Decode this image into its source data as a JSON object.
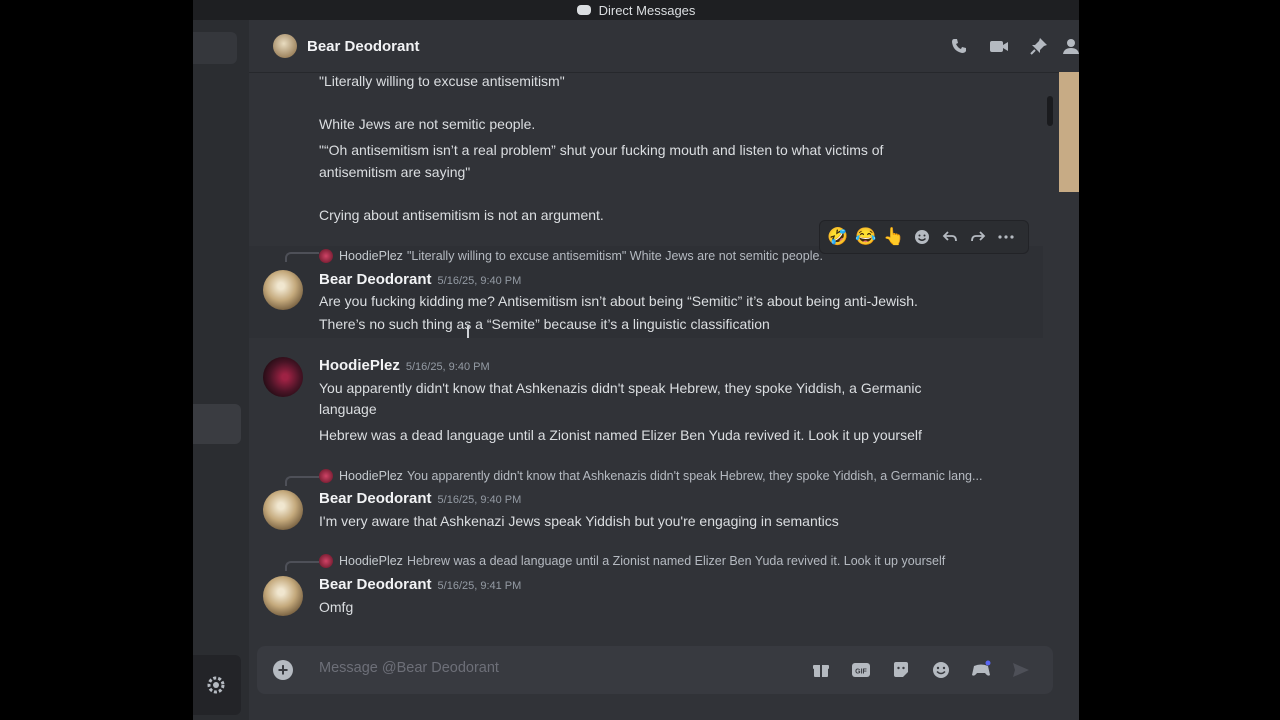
{
  "window": {
    "title": "Direct Messages"
  },
  "header": {
    "user_name": "Bear Deodorant"
  },
  "composer": {
    "placeholder": "Message @Bear Deodorant"
  },
  "messages": {
    "m1": "\"Literally willing to excuse antisemitism\"",
    "m2": "White Jews are not semitic people.",
    "m3a": "\"“Oh antisemitism isn’t a real problem” shut your fucking mouth and listen to what victims of",
    "m3b": "antisemitism are saying\"",
    "m4": "Crying about antisemitism is not an argument.",
    "r1_name": "HoodiePlez",
    "r1_text": "\"Literally willing to excuse antisemitism\"  White Jews are not semitic people.",
    "g1_name": "Bear Deodorant",
    "g1_time": "5/16/25, 9:40 PM",
    "g1_l1": "Are you fucking kidding me? Antisemitism isn’t about being “Semitic” it’s about being anti-Jewish.",
    "g1_l2": "There’s no such thing as a “Semite” because it’s a linguistic classification",
    "g2_name": "HoodiePlez",
    "g2_time": "5/16/25, 9:40 PM",
    "g2_l1": "You apparently didn't know that Ashkenazis didn't speak Hebrew, they spoke Yiddish, a Germanic",
    "g2_l2": "language",
    "g2_l3": "Hebrew was a dead language until a Zionist named Elizer Ben Yuda revived it. Look it up yourself",
    "r2_name": "HoodiePlez",
    "r2_text": "You apparently didn't know that Ashkenazis didn't speak Hebrew, they spoke Yiddish, a Germanic lang...",
    "g3_name": "Bear Deodorant",
    "g3_time": "5/16/25, 9:40 PM",
    "g3_l1": "I'm very aware that Ashkenazi Jews speak Yiddish but you're engaging in semantics",
    "r3_name": "HoodiePlez",
    "r3_text": "Hebrew was a dead language until a Zionist named Elizer Ben Yuda revived it. Look it up yourself",
    "g4_name": "Bear Deodorant",
    "g4_time": "5/16/25, 9:41 PM",
    "g4_l1": "Omfg"
  },
  "toolbar": {
    "emoji1": "🤣",
    "emoji2": "😂",
    "emoji3": "👆"
  },
  "icons": {
    "header": [
      "phone-icon",
      "video-icon",
      "pin-icon",
      "add-friend-icon"
    ],
    "toolbar": [
      "add-reaction-icon",
      "reply-icon",
      "forward-icon",
      "more-icon"
    ],
    "composer": [
      "gift-icon",
      "gif-icon",
      "sticker-icon",
      "emoji-icon",
      "activity-icon",
      "send-icon"
    ]
  }
}
